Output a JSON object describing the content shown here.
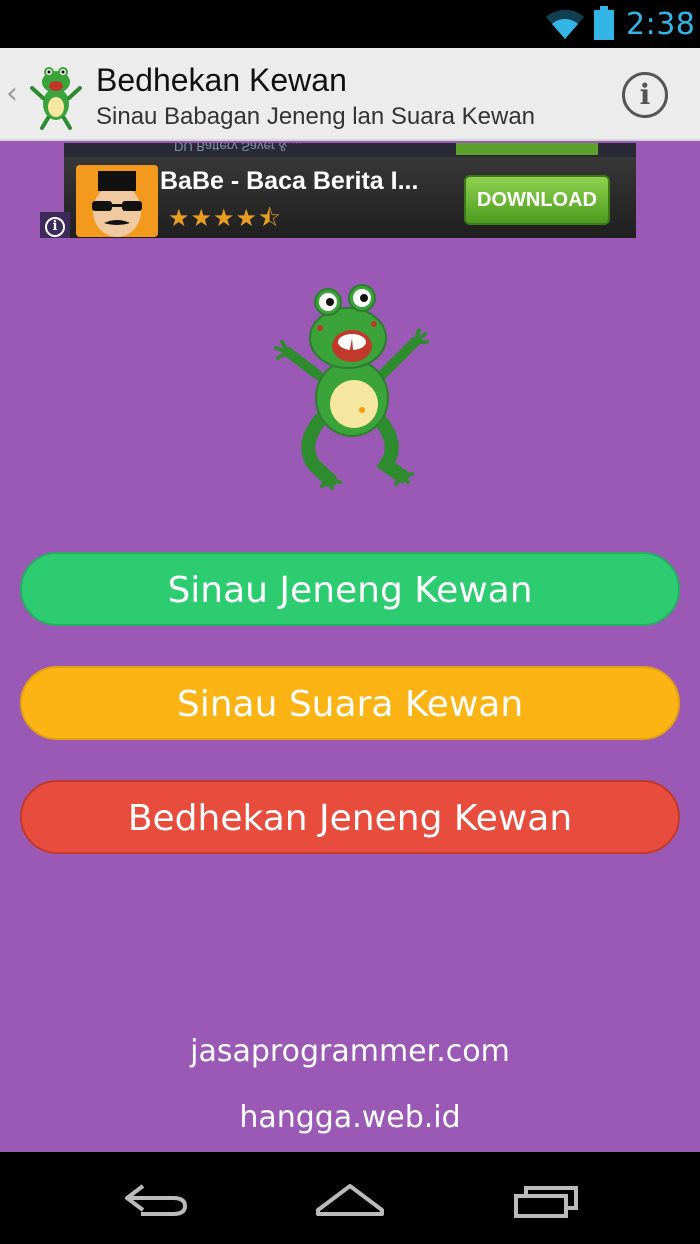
{
  "status_bar": {
    "time": "2:38",
    "icons": [
      "wifi-icon",
      "battery-icon"
    ],
    "accent_color": "#33b5e5"
  },
  "action_bar": {
    "back_glyph": "‹",
    "title": "Bedhekan Kewan",
    "subtitle": "Sinau Babagan Jeneng lan Suara Kewan",
    "info_glyph": "i"
  },
  "ad": {
    "title": "BaBe - Baca Berita I...",
    "stars": "★★★★⯪",
    "rating": 4.5,
    "download_label": "DOWNLOAD",
    "strip_text": "DU Battery Saver & ...",
    "info_glyph": "i"
  },
  "menu": {
    "buttons": [
      {
        "label": "Sinau Jeneng Kewan",
        "color": "#2ecc71"
      },
      {
        "label": "Sinau Suara Kewan",
        "color": "#fcb415"
      },
      {
        "label": "Bedhekan Jeneng Kewan",
        "color": "#e74c3c"
      }
    ]
  },
  "footer": {
    "link1": "jasaprogrammer.com",
    "link2": "hangga.web.id"
  },
  "colors": {
    "background": "#9b59b6",
    "action_bar": "#ececec"
  },
  "nav_bar": {
    "icons": [
      "back-icon",
      "home-icon",
      "recent-apps-icon"
    ]
  }
}
